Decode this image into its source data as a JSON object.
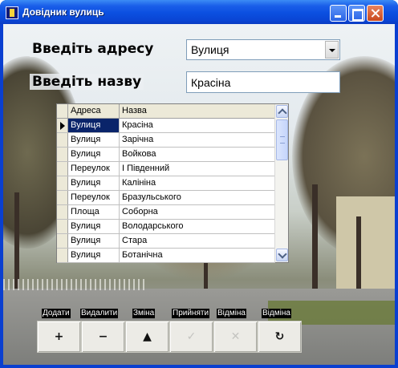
{
  "window": {
    "title": "Довідник вулиць"
  },
  "form": {
    "address_label": "Введіть адресу",
    "address_value": "Вулиця",
    "name_label": "Введіть назву",
    "name_value": "Красіна"
  },
  "grid": {
    "columns": [
      "Адреса",
      "Назва"
    ],
    "selected_row": 0,
    "rows": [
      [
        "Вулиця",
        "Красіна"
      ],
      [
        "Вулиця",
        "Зарічна"
      ],
      [
        "Вулиця",
        "Войкова"
      ],
      [
        "Переулок",
        "І Південний"
      ],
      [
        "Вулиця",
        "Калініна"
      ],
      [
        "Переулок",
        "Бразульського"
      ],
      [
        "Площа",
        "Соборна"
      ],
      [
        "Вулиця",
        "Володарського"
      ],
      [
        "Вулиця",
        "Стара"
      ],
      [
        "Вулиця",
        "Ботанічна"
      ]
    ]
  },
  "toolbar": {
    "buttons": [
      {
        "label": "Додати",
        "icon": "plus-icon",
        "glyph": "+",
        "enabled": true
      },
      {
        "label": "Видалити",
        "icon": "minus-icon",
        "glyph": "−",
        "enabled": true
      },
      {
        "label": "Зміна",
        "icon": "triangle-up-icon",
        "glyph": "▲",
        "enabled": true
      },
      {
        "label": "Прийняти",
        "icon": "checkmark-icon",
        "glyph": "✓",
        "enabled": false
      },
      {
        "label": "Відміна",
        "icon": "cross-icon",
        "glyph": "✕",
        "enabled": false
      },
      {
        "label": "Відміна",
        "icon": "refresh-icon",
        "glyph": "↻",
        "enabled": true
      }
    ]
  }
}
